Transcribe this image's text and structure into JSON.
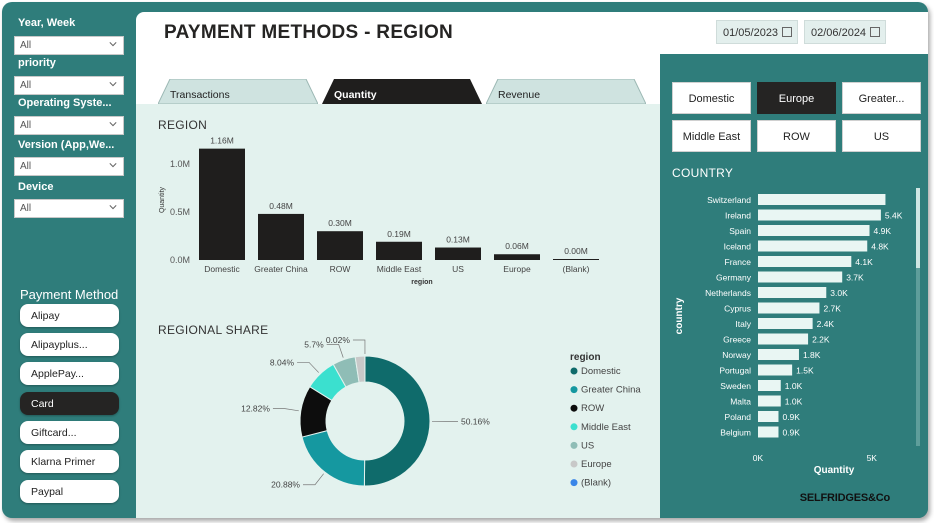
{
  "header": {
    "title": "PAYMENT METHODS - REGION",
    "date_from": "01/05/2023",
    "date_to": "02/06/2024"
  },
  "filters": [
    {
      "label": "Year, Week",
      "value": "All"
    },
    {
      "label": "priority",
      "value": "All"
    },
    {
      "label": "Operating Syste...",
      "value": "All"
    },
    {
      "label": "Version (App,We...",
      "value": "All"
    },
    {
      "label": "Device",
      "value": "All"
    }
  ],
  "payment_method": {
    "title": "Payment Method",
    "items": [
      {
        "label": "Alipay",
        "selected": false
      },
      {
        "label": "Alipayplus...",
        "selected": false
      },
      {
        "label": "ApplePay...",
        "selected": false
      },
      {
        "label": "Card",
        "selected": true
      },
      {
        "label": "Giftcard...",
        "selected": false
      },
      {
        "label": "Klarna Primer",
        "selected": false
      },
      {
        "label": "Paypal",
        "selected": false
      }
    ]
  },
  "tabs": [
    {
      "label": "Transactions",
      "active": false
    },
    {
      "label": "Quantity",
      "active": true
    },
    {
      "label": "Revenue",
      "active": false
    }
  ],
  "region_buttons": [
    {
      "label": "Domestic",
      "selected": false
    },
    {
      "label": "Europe",
      "selected": true
    },
    {
      "label": "Greater...",
      "selected": false
    },
    {
      "label": "Middle East",
      "selected": false
    },
    {
      "label": "ROW",
      "selected": false
    },
    {
      "label": "US",
      "selected": false
    }
  ],
  "region_title": "REGION",
  "share_title": "REGIONAL SHARE",
  "country_title": "COUNTRY",
  "logo_text": "SELFRIDGES&Co",
  "colors": {
    "teal_bg": "#2f7d7b",
    "panel_bg": "#e3f2ee",
    "dark": "#252423",
    "country_bar": "#e9f6f3"
  },
  "chart_data": [
    {
      "type": "bar",
      "title": "REGION",
      "categories": [
        "Domestic",
        "Greater China",
        "ROW",
        "Middle East",
        "US",
        "Europe",
        "(Blank)"
      ],
      "values": [
        1160000,
        480000,
        300000,
        190000,
        130000,
        60000,
        0
      ],
      "data_labels": [
        "1.16M",
        "0.48M",
        "0.30M",
        "0.19M",
        "0.13M",
        "0.06M",
        "0.00M"
      ],
      "xlabel": "region",
      "ylabel": "Quantity",
      "yticks": [
        "0.0M",
        "0.5M",
        "1.0M"
      ],
      "ylim": [
        0,
        1250000
      ],
      "color": "#1f1e1d"
    },
    {
      "type": "pie",
      "title": "REGIONAL SHARE",
      "donut": true,
      "legend_title": "region",
      "series": [
        {
          "name": "Domestic",
          "value": 50.16,
          "label": "50.16%",
          "color": "#0f6b6b"
        },
        {
          "name": "Greater China",
          "value": 20.88,
          "label": "20.88%",
          "color": "#1598a0"
        },
        {
          "name": "ROW",
          "value": 12.82,
          "label": "12.82%",
          "color": "#0d0d0d"
        },
        {
          "name": "Middle East",
          "value": 8.04,
          "label": "8.04%",
          "color": "#3be0cf"
        },
        {
          "name": "US",
          "value": 5.7,
          "label": "5.7%",
          "color": "#8fbdb6"
        },
        {
          "name": "Europe",
          "value": 2.4,
          "label": "",
          "color": "#c8c8c8"
        },
        {
          "name": "(Blank)",
          "value": 0.02,
          "label": "0.02%",
          "color": "#3a86e8"
        }
      ]
    },
    {
      "type": "bar",
      "orientation": "horizontal",
      "title": "COUNTRY",
      "ylabel": "country",
      "xlabel": "Quantity",
      "xticks": [
        "0K",
        "5K"
      ],
      "xlim": [
        0,
        5800
      ],
      "categories": [
        "Switzerland",
        "Ireland",
        "Spain",
        "Iceland",
        "France",
        "Germany",
        "Netherlands",
        "Cyprus",
        "Italy",
        "Greece",
        "Norway",
        "Portugal",
        "Sweden",
        "Malta",
        "Poland",
        "Belgium"
      ],
      "values": [
        5600,
        5400,
        4900,
        4800,
        4100,
        3700,
        3000,
        2700,
        2400,
        2200,
        1800,
        1500,
        1000,
        1000,
        900,
        900
      ],
      "data_labels": [
        "",
        "5.4K",
        "4.9K",
        "4.8K",
        "4.1K",
        "3.7K",
        "3.0K",
        "2.7K",
        "2.4K",
        "2.2K",
        "1.8K",
        "1.5K",
        "1.0K",
        "1.0K",
        "0.9K",
        "0.9K"
      ],
      "color": "#e9f6f3"
    }
  ]
}
